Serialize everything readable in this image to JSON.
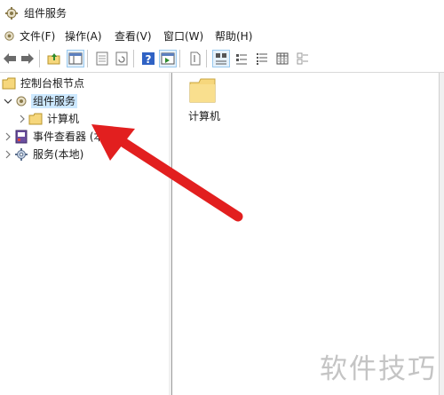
{
  "window": {
    "title": "组件服务"
  },
  "menu": {
    "items": [
      "文件(F)",
      "操作(A)",
      "查看(V)",
      "窗口(W)",
      "帮助(H)"
    ]
  },
  "tree": {
    "root_label": "控制台根节点",
    "component_services_label": "组件服务",
    "computers_label": "计算机",
    "event_viewer_label": "事件查看器 (本",
    "services_label": "服务(本地)"
  },
  "content": {
    "items": [
      "计算机"
    ]
  },
  "watermark": "软件技巧",
  "colors": {
    "selection": "#cce8ff",
    "folder": "#f6d77c",
    "arrow": "#e21f1f",
    "help_icon": "#2f62c4"
  }
}
